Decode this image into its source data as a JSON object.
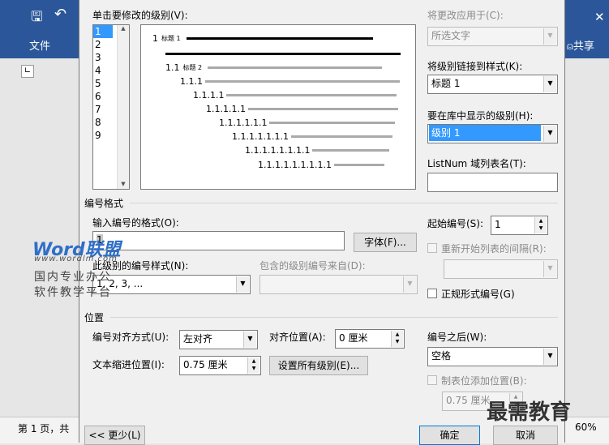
{
  "word": {
    "file_tab": "文件",
    "share": "共享",
    "status_page": "第 1 页，共",
    "zoom": "60%"
  },
  "dialog": {
    "click_level_label": "单击要修改的级别(V):",
    "levels": [
      "1",
      "2",
      "3",
      "4",
      "5",
      "6",
      "7",
      "8",
      "9"
    ],
    "preview": {
      "rows": [
        {
          "num": "1",
          "small": "标题 1"
        },
        {
          "num": "",
          "small": ""
        },
        {
          "num": "1.1",
          "small": "标题 2"
        },
        {
          "num": "1.1.1",
          "small": ""
        },
        {
          "num": "1.1.1.1",
          "small": ""
        },
        {
          "num": "1.1.1.1.1",
          "small": ""
        },
        {
          "num": "1.1.1.1.1.1",
          "small": ""
        },
        {
          "num": "1.1.1.1.1.1.1",
          "small": ""
        },
        {
          "num": "1.1.1.1.1.1.1.1",
          "small": ""
        },
        {
          "num": "1.1.1.1.1.1.1.1.1",
          "small": ""
        }
      ]
    },
    "apply_to_label": "将更改应用于(C):",
    "apply_to_value": "所选文字",
    "link_style_label": "将级别链接到样式(K):",
    "link_style_value": "标题 1",
    "gallery_level_label": "要在库中显示的级别(H):",
    "gallery_level_value": "级别 1",
    "listnum_label": "ListNum 域列表名(T):",
    "listnum_value": "",
    "number_format_section": "编号格式",
    "enter_format_label": "输入编号的格式(O):",
    "font_button": "字体(F)...",
    "start_at_label": "起始编号(S):",
    "start_at_value": "1",
    "restart_label": "重新开始列表的间隔(R):",
    "number_style_label": "此级别的编号样式(N):",
    "number_style_value": "1, 2, 3, ...",
    "include_level_label": "包含的级别编号来自(D):",
    "legal_style_label": "正规形式编号(G)",
    "position_section": "位置",
    "alignment_label": "编号对齐方式(U):",
    "alignment_value": "左对齐",
    "aligned_at_label": "对齐位置(A):",
    "aligned_at_value": "0 厘米",
    "follow_label": "编号之后(W):",
    "follow_value": "空格",
    "indent_label": "文本缩进位置(I):",
    "indent_value": "0.75 厘米",
    "set_all_button": "设置所有级别(E)...",
    "tab_stop_label": "制表位添加位置(B):",
    "tab_stop_value": "0.75 厘米",
    "less_button": "<< 更少(L)",
    "ok_button": "确定",
    "cancel_button": "取消"
  },
  "watermarks": {
    "wordlm_brand": "Word联盟",
    "wordlm_url": "www.wordlm.com",
    "wordlm_line1": "国内专业办公",
    "wordlm_line2": "软件教学平台",
    "corner_text": "最需教育"
  }
}
